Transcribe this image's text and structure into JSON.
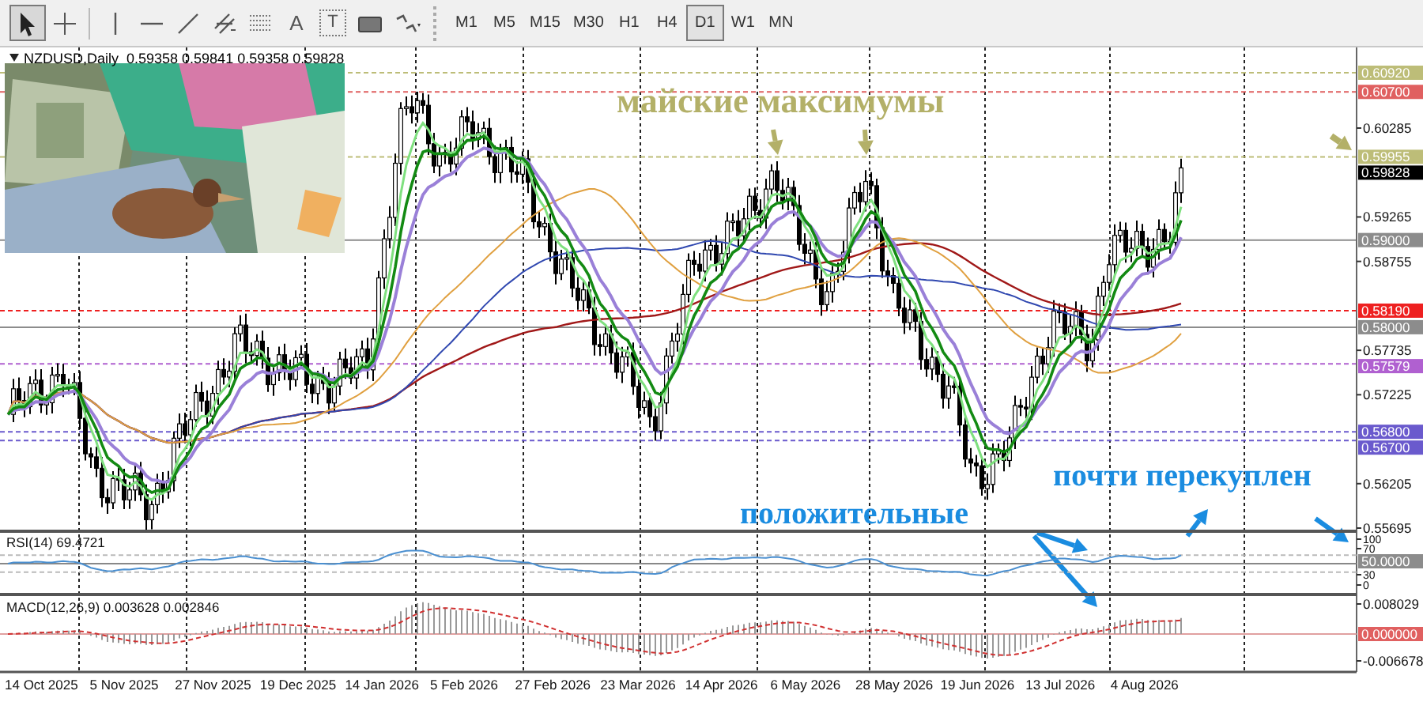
{
  "toolbar": {
    "tools": [
      {
        "kind": "cursor",
        "selected": true
      },
      {
        "kind": "crosshair",
        "selected": false
      },
      {
        "kind": "vertical-line",
        "selected": false
      },
      {
        "kind": "horizontal-line",
        "selected": false
      },
      {
        "kind": "trend-line",
        "selected": false
      },
      {
        "kind": "channel",
        "selected": false
      },
      {
        "kind": "fibonacci",
        "selected": false
      },
      {
        "kind": "letter",
        "glyph": "A",
        "selected": false
      },
      {
        "kind": "label",
        "glyph": "T",
        "selected": false
      },
      {
        "kind": "rectangle",
        "selected": false
      },
      {
        "kind": "shapes",
        "selected": false
      }
    ],
    "timeframes": [
      {
        "label": "M1",
        "selected": false
      },
      {
        "label": "M5",
        "selected": false
      },
      {
        "label": "M15",
        "selected": false
      },
      {
        "label": "M30",
        "selected": false
      },
      {
        "label": "H1",
        "selected": false
      },
      {
        "label": "H4",
        "selected": false
      },
      {
        "label": "D1",
        "selected": true
      },
      {
        "label": "W1",
        "selected": false
      },
      {
        "label": "MN",
        "selected": false
      }
    ]
  },
  "chart": {
    "symbol_info": "NZDUSD,Daily  0.59358 0.59841 0.59358 0.59828",
    "price_labels": [
      {
        "text": "0.60920",
        "kind": "dashed-level",
        "color": "#bdbd78"
      },
      {
        "text": "0.60700",
        "kind": "dashed-level",
        "color": "#e06060"
      },
      {
        "text": "0.60285",
        "kind": "tick"
      },
      {
        "text": "0.59955",
        "kind": "dashed-level",
        "color": "#bdbd78"
      },
      {
        "text": "0.59828",
        "kind": "current",
        "color": "#000000"
      },
      {
        "text": "0.59265",
        "kind": "tick"
      },
      {
        "text": "0.59000",
        "kind": "solid-level",
        "color": "#8c8c8c"
      },
      {
        "text": "0.58755",
        "kind": "tick"
      },
      {
        "text": "0.58190",
        "kind": "dashed-level",
        "color": "#ee2020"
      },
      {
        "text": "0.58000",
        "kind": "solid-level",
        "color": "#8c8c8c"
      },
      {
        "text": "0.57735",
        "kind": "tick"
      },
      {
        "text": "0.57579",
        "kind": "dashed-level",
        "color": "#b060d0"
      },
      {
        "text": "0.57225",
        "kind": "tick"
      },
      {
        "text": "0.56800",
        "kind": "dashed-level",
        "color": "#6a5acd"
      },
      {
        "text": "0.56700",
        "kind": "dashed-level",
        "color": "#6a5acd"
      },
      {
        "text": "0.56205",
        "kind": "tick"
      },
      {
        "text": "0.55695",
        "kind": "tick"
      }
    ],
    "annotations": [
      {
        "text": "майские максимумы",
        "color": "#b3b068"
      },
      {
        "text": "почти перекуплен",
        "color": "#1a8ce0"
      },
      {
        "text": "положительные",
        "color": "#1a8ce0"
      }
    ],
    "dates": [
      "14 Oct 2025",
      "5 Nov 2025",
      "27 Nov 2025",
      "19 Dec 2025",
      "14 Jan 2026",
      "5 Feb 2026",
      "27 Feb 2026",
      "23 Mar 2026",
      "14 Apr 2026",
      "6 May 2026",
      "28 May 2026",
      "19 Jun 2026",
      "13 Jul 2026",
      "4 Aug 2026"
    ]
  },
  "rsi": {
    "label": "RSI(14) 69.4721",
    "scale": [
      {
        "text": "100",
        "kind": "tick"
      },
      {
        "text": "70",
        "kind": "tick"
      },
      {
        "text": "50.0000",
        "kind": "tag",
        "color": "#8c8c8c"
      },
      {
        "text": "30",
        "kind": "tick"
      },
      {
        "text": "0",
        "kind": "tick"
      }
    ]
  },
  "macd": {
    "label": "MACD(12,26,9) 0.003628 0.002846",
    "scale": [
      {
        "text": "0.008029",
        "kind": "tick"
      },
      {
        "text": "0.000000",
        "kind": "tag",
        "color": "#e06060"
      },
      {
        "text": "-0.006678",
        "kind": "tick"
      }
    ]
  }
}
